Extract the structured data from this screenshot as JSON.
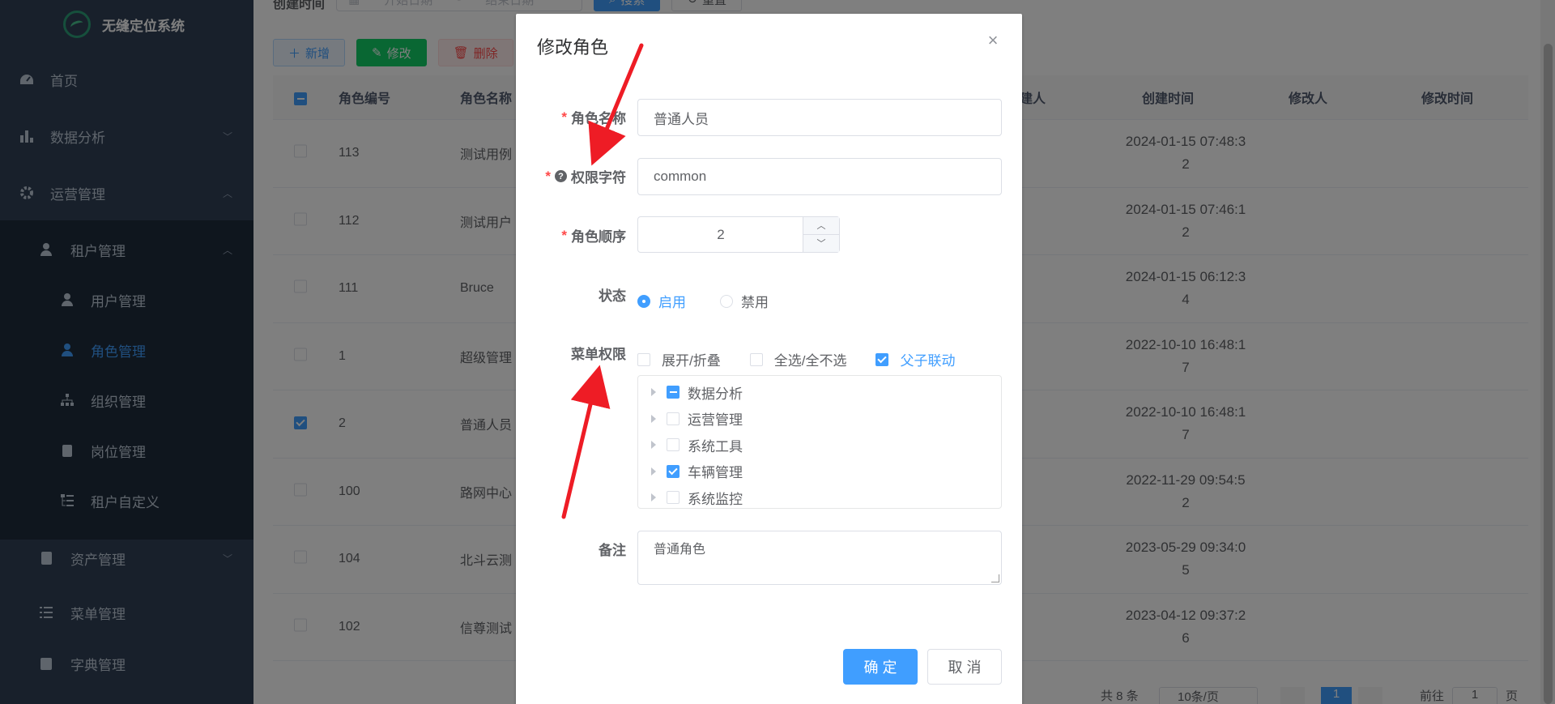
{
  "app": {
    "logo_text": "无缝定位系统"
  },
  "sidebar": {
    "items": [
      {
        "label": "首页",
        "icon": "dashboard-icon"
      },
      {
        "label": "数据分析",
        "icon": "bar-chart-icon"
      },
      {
        "label": "运营管理",
        "icon": "gear-icon"
      },
      {
        "label": "租户管理",
        "icon": "user-icon"
      },
      {
        "label": "用户管理",
        "icon": "user-icon"
      },
      {
        "label": "角色管理",
        "icon": "peoples-icon"
      },
      {
        "label": "组织管理",
        "icon": "tree-icon"
      },
      {
        "label": "岗位管理",
        "icon": "post-icon"
      },
      {
        "label": "租户自定义",
        "icon": "tree-table-icon"
      },
      {
        "label": "资产管理",
        "icon": "document-icon"
      },
      {
        "label": "菜单管理",
        "icon": "list-icon"
      },
      {
        "label": "字典管理",
        "icon": "dict-icon"
      }
    ]
  },
  "search": {
    "created_label": "创建时间",
    "start_placeholder": "开始日期",
    "separator": "-",
    "end_placeholder": "结束日期",
    "search_button": "搜索",
    "reset_button": "重置"
  },
  "toolbar": {
    "add": "新增",
    "edit": "修改",
    "delete": "删除"
  },
  "table": {
    "headers": {
      "role_id": "角色编号",
      "role_name": "角色名称",
      "creator": "建人",
      "create_time": "创建时间",
      "modifier": "修改人",
      "modify_time": "修改时间"
    },
    "rows": [
      {
        "id": "113",
        "name": "测试用例",
        "time1": "2024-01-15 07:48:3",
        "time2": "2",
        "checked": false
      },
      {
        "id": "112",
        "name": "测试用户",
        "time1": "2024-01-15 07:46:1",
        "time2": "2",
        "checked": false
      },
      {
        "id": "111",
        "name": "Bruce",
        "time1": "2024-01-15 06:12:3",
        "time2": "4",
        "checked": false
      },
      {
        "id": "1",
        "name": "超级管理",
        "time1": "2022-10-10 16:48:1",
        "time2": "7",
        "checked": false
      },
      {
        "id": "2",
        "name": "普通人员",
        "time1": "2022-10-10 16:48:1",
        "time2": "7",
        "checked": true
      },
      {
        "id": "100",
        "name": "路网中心",
        "time1": "2022-11-29 09:54:5",
        "time2": "2",
        "checked": false
      },
      {
        "id": "104",
        "name": "北斗云测",
        "time1": "2023-05-29 09:34:0",
        "time2": "5",
        "checked": false
      },
      {
        "id": "102",
        "name": "信尊测试",
        "time1": "2023-04-12 09:37:2",
        "time2": "6",
        "checked": false
      }
    ]
  },
  "pagination": {
    "total": "共 8 条",
    "page_size": "10条/页",
    "current_page": "1",
    "goto_label": "前往",
    "goto_value": "1",
    "page_suffix": "页"
  },
  "dialog": {
    "title": "修改角色",
    "role_name_label": "角色名称",
    "role_name_value": "普通人员",
    "permission_label": "权限字符",
    "permission_value": "common",
    "order_label": "角色顺序",
    "order_value": "2",
    "status_label": "状态",
    "status_enabled": "启用",
    "status_disabled": "禁用",
    "menu_perm_label": "菜单权限",
    "expand_collapse": "展开/折叠",
    "select_all": "全选/全不选",
    "parent_child_link": "父子联动",
    "tree": [
      {
        "label": "数据分析",
        "state": "indeterminate"
      },
      {
        "label": "运营管理",
        "state": "unchecked"
      },
      {
        "label": "系统工具",
        "state": "unchecked"
      },
      {
        "label": "车辆管理",
        "state": "checked"
      },
      {
        "label": "系统监控",
        "state": "unchecked"
      }
    ],
    "remark_label": "备注",
    "remark_value": "普通角色",
    "ok_button": "确 定",
    "cancel_button": "取 消"
  },
  "colors": {
    "primary": "#409eff",
    "sidebar_bg": "#304156",
    "submenu_bg": "#1f2d3d",
    "danger": "#ff4949",
    "success": "#13ce66",
    "annotation_arrow": "#ee1c25"
  }
}
